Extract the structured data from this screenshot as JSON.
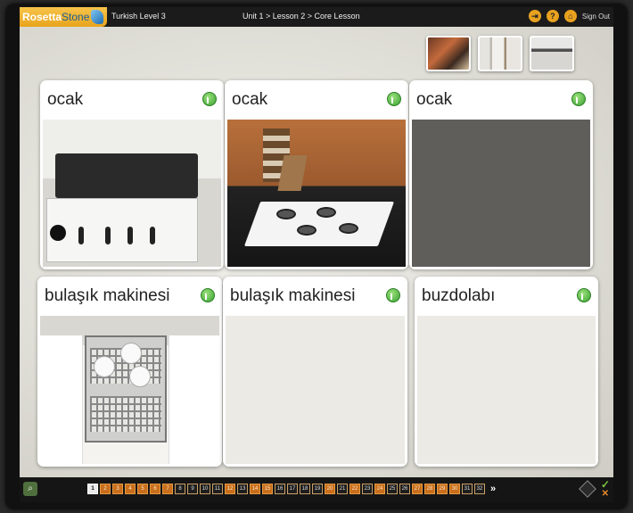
{
  "header": {
    "brand_main": "Rosetta",
    "brand_accent": "Stone",
    "level": "Turkish Level 3",
    "breadcrumb": "Unit 1 > Lesson 2 > Core Lesson",
    "sign_out": "Sign Out",
    "icons": [
      "exit-icon",
      "help-icon",
      "home-icon"
    ]
  },
  "thumbnails": [
    "kitchen-photo-1",
    "kitchen-photo-2",
    "kitchen-photo-3"
  ],
  "cards": [
    {
      "label": "ocak",
      "picture": "stove-white"
    },
    {
      "label": "ocak",
      "picture": "stove-gas-hob"
    },
    {
      "label": "ocak",
      "picture": "blank-dark"
    },
    {
      "label": "bulaşık makinesi",
      "picture": "dishwasher"
    },
    {
      "label": "bulaşık makinesi",
      "picture": "blank-light"
    },
    {
      "label": "buzdolabı",
      "picture": "blank-light"
    }
  ],
  "pager": {
    "pages": [
      "1",
      "2",
      "3",
      "4",
      "5",
      "6",
      "7",
      "8",
      "9",
      "10",
      "11",
      "12",
      "13",
      "14",
      "15",
      "16",
      "17",
      "18",
      "19",
      "20",
      "21",
      "22",
      "23",
      "24",
      "25",
      "26",
      "27",
      "28",
      "29",
      "30",
      "31",
      "32"
    ],
    "current": "1",
    "orange_pages": [
      "2",
      "3",
      "4",
      "5",
      "6",
      "7",
      "12",
      "14",
      "15",
      "20",
      "22",
      "24",
      "27",
      "28",
      "29",
      "30"
    ],
    "next": "»"
  },
  "colors": {
    "accent_orange": "#e8a21f",
    "speaker_green": "#3aa233",
    "brand_blue": "#1b5f97"
  }
}
